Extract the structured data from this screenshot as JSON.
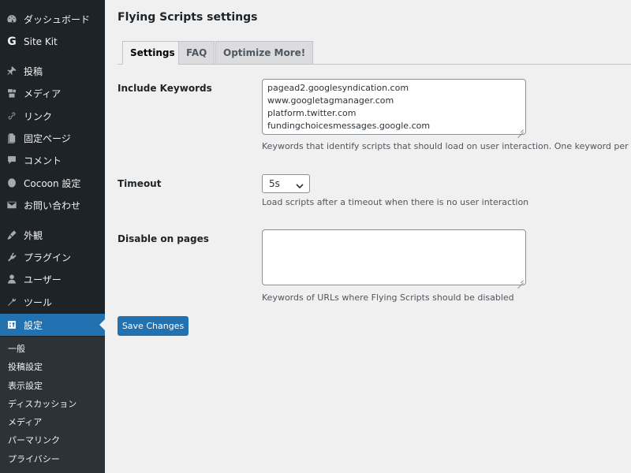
{
  "sidebar": {
    "items": [
      {
        "label": "ダッシュボード",
        "icon": "dashboard-icon"
      },
      {
        "label": "Site Kit",
        "icon": "google-g-icon"
      },
      {
        "label": "投稿",
        "icon": "pin-icon"
      },
      {
        "label": "メディア",
        "icon": "media-icon"
      },
      {
        "label": "リンク",
        "icon": "link-icon"
      },
      {
        "label": "固定ページ",
        "icon": "page-icon"
      },
      {
        "label": "コメント",
        "icon": "comment-icon"
      },
      {
        "label": "Cocoon 設定",
        "icon": "cocoon-icon"
      },
      {
        "label": "お問い合わせ",
        "icon": "mail-icon"
      },
      {
        "label": "外観",
        "icon": "brush-icon"
      },
      {
        "label": "プラグイン",
        "icon": "plugin-icon"
      },
      {
        "label": "ユーザー",
        "icon": "user-icon"
      },
      {
        "label": "ツール",
        "icon": "wrench-icon"
      },
      {
        "label": "設定",
        "icon": "settings-icon",
        "current": true
      }
    ],
    "submenu": [
      "一般",
      "投稿設定",
      "表示設定",
      "ディスカッション",
      "メディア",
      "パーマリンク",
      "プライバシー"
    ]
  },
  "page": {
    "title": "Flying Scripts settings",
    "tabs": [
      "Settings",
      "FAQ",
      "Optimize More!"
    ],
    "active_tab": "Settings"
  },
  "form": {
    "include_keywords": {
      "label": "Include Keywords",
      "lines": [
        "pagead2.googlesyndication.com",
        "www.googletagmanager.com",
        "platform.twitter.com",
        "fundingchoicesmessages.google.com"
      ],
      "description": "Keywords that identify scripts that should load on user interaction. One keyword per line"
    },
    "timeout": {
      "label": "Timeout",
      "value": "5s",
      "description": "Load scripts after a timeout when there is no user interaction"
    },
    "disable_on_pages": {
      "label": "Disable on pages",
      "value": "",
      "description": "Keywords of URLs where Flying Scripts should be disabled"
    },
    "save_label": "Save Changes"
  },
  "colors": {
    "sidebar_bg": "#1d2327",
    "submenu_bg": "#2c3338",
    "accent": "#2271b1",
    "page_bg": "#f0f0f1"
  }
}
